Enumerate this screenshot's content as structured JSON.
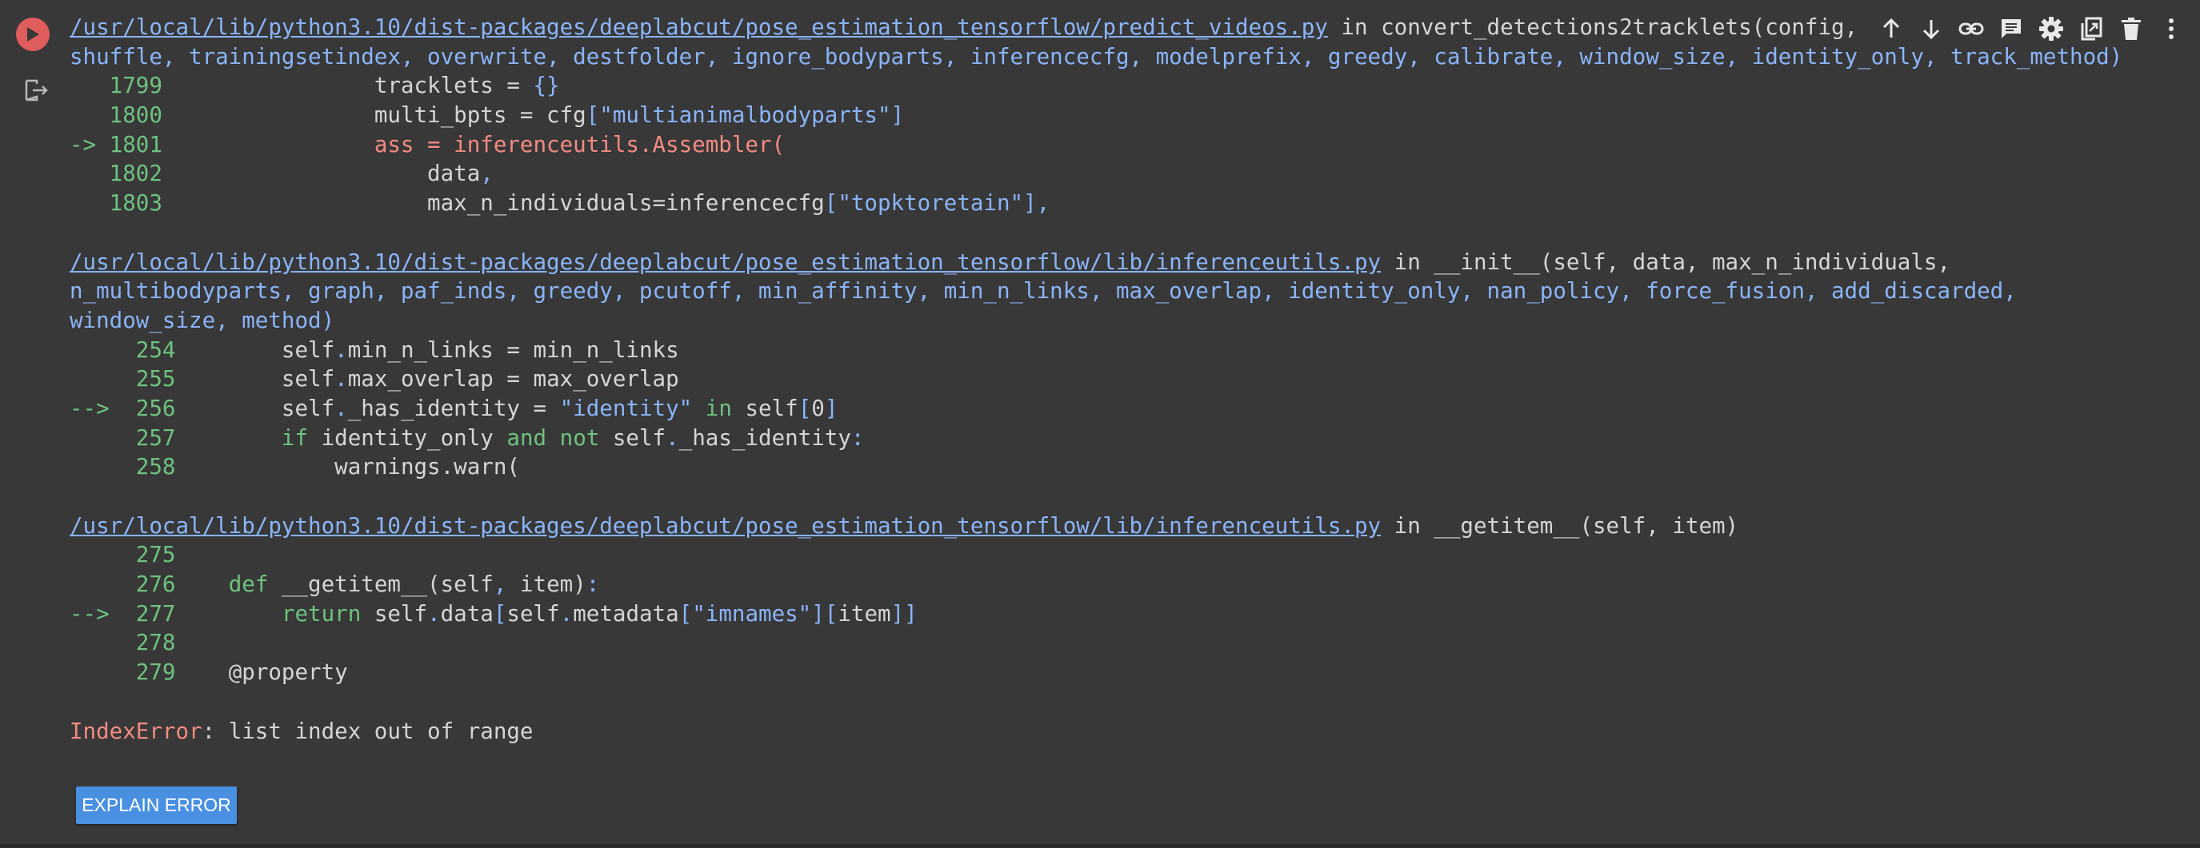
{
  "toolbar": {
    "icons": [
      "arrow-up-icon",
      "arrow-down-icon",
      "link-icon",
      "comment-icon",
      "gear-icon",
      "mirror-cell-icon",
      "trash-icon",
      "more-vert-icon"
    ]
  },
  "traceback": {
    "frame1": {
      "path": "/usr/local/lib/python3.10/dist-packages/deeplabcut/pose_estimation_tensorflow/predict_videos.py",
      "sig_line1_in": " in convert_detections2tracklets(config, videos, videotype,",
      "sig_line2": "shuffle, trainingsetindex, overwrite, destfolder, ignore_bodyparts, inferencecfg, modelprefix, greedy, calibrate, window_size, identity_only, track_method)",
      "lines": [
        {
          "arrow": "   ",
          "num": "1799",
          "indent": "                ",
          "code": "tracklets = {}"
        },
        {
          "arrow": "   ",
          "num": "1800",
          "indent": "                ",
          "code": "multi_bpts = cfg[\"multianimalbodyparts\"]"
        },
        {
          "arrow": "-> ",
          "num": "1801",
          "indent": "                ",
          "code": "ass = inferenceutils.Assembler("
        },
        {
          "arrow": "   ",
          "num": "1802",
          "indent": "                    ",
          "code": "data,"
        },
        {
          "arrow": "   ",
          "num": "1803",
          "indent": "                    ",
          "code": "max_n_individuals=inferencecfg[\"topktoretain\"],"
        }
      ]
    },
    "frame2": {
      "path": "/usr/local/lib/python3.10/dist-packages/deeplabcut/pose_estimation_tensorflow/lib/inferenceutils.py",
      "sig_line1_in": " in __init__(self, data, max_n_individuals,",
      "sig_line2": "n_multibodyparts, graph, paf_inds, greedy, pcutoff, min_affinity, min_n_links, max_overlap, identity_only, nan_policy, force_fusion, add_discarded,",
      "sig_line3": "window_size, method)",
      "lines": [
        {
          "arrow": "    ",
          "num": " 254",
          "indent": "        ",
          "code": "self.min_n_links = min_n_links"
        },
        {
          "arrow": "    ",
          "num": " 255",
          "indent": "        ",
          "code": "self.max_overlap = max_overlap"
        },
        {
          "arrow": "--> ",
          "num": " 256",
          "indent": "        ",
          "code": "self._has_identity = \"identity\" in self[0]"
        },
        {
          "arrow": "    ",
          "num": " 257",
          "indent": "        ",
          "code": "if identity_only and not self._has_identity:"
        },
        {
          "arrow": "    ",
          "num": " 258",
          "indent": "            ",
          "code": "warnings.warn("
        }
      ]
    },
    "frame3": {
      "path": "/usr/local/lib/python3.10/dist-packages/deeplabcut/pose_estimation_tensorflow/lib/inferenceutils.py",
      "sig_line1_in": " in __getitem__(self, item)",
      "lines": [
        {
          "arrow": "    ",
          "num": " 275",
          "indent": "",
          "code": ""
        },
        {
          "arrow": "    ",
          "num": " 276",
          "indent": "    ",
          "code": "def __getitem__(self, item):"
        },
        {
          "arrow": "--> ",
          "num": " 277",
          "indent": "        ",
          "code": "return self.data[self.metadata[\"imnames\"][item]]"
        },
        {
          "arrow": "    ",
          "num": " 278",
          "indent": "",
          "code": ""
        },
        {
          "arrow": "    ",
          "num": " 279",
          "indent": "    ",
          "code": "@property"
        }
      ]
    },
    "error_type": "IndexError",
    "error_message": ": list index out of range"
  },
  "explain_button": {
    "label": "EXPLAIN ERROR"
  },
  "colors": {
    "background": "#383838",
    "link": "#8ab4f8",
    "line_number": "#6ec27f",
    "error": "#f28b82",
    "button": "#4a90e2",
    "run_button": "#e05d5d"
  }
}
